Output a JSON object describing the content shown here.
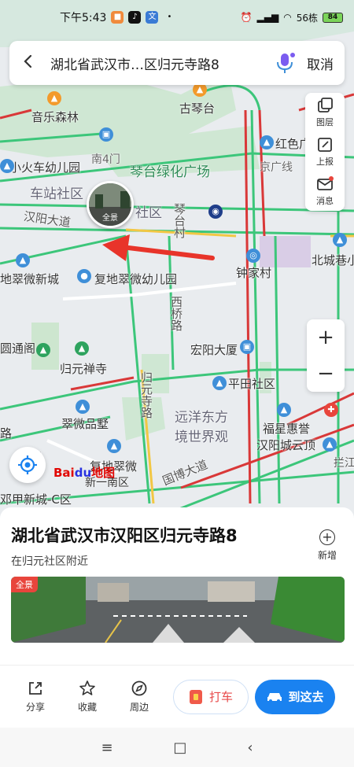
{
  "status_bar": {
    "time": "下午5:43",
    "network_speed": "56栋",
    "battery": "84"
  },
  "search": {
    "query": "湖北省武汉市…区归元寺路8",
    "cancel_label": "取消"
  },
  "map_tools": {
    "layers_label": "图层",
    "report_label": "上报",
    "messages_label": "消息"
  },
  "map": {
    "pano_marker_label": "全景",
    "logo_text_1": "Bai",
    "logo_text_2": "du",
    "logo_text_3": "地图",
    "labels": {
      "music_forest": "音乐森林",
      "guqintai": "古琴台",
      "south4gate": "南4门",
      "red_color": "红色广",
      "kindergarten_train": "小火车幼儿园",
      "qintai_square": "琴台绿化广场",
      "jingguang_line": "京广线",
      "station_community": "车站社区",
      "community_short": "社区",
      "qintai_village": "琴台村",
      "hanyang_avenue": "汉阳大道",
      "beicheng_alley": "北城巷小",
      "dicuiwei_new_city": "地翠微新城",
      "fudi_kindergarten": "复地翠微幼儿园",
      "zhongjia_village": "钟家村",
      "xiqiao_road": "西桥路",
      "yuantong_pavilion": "圆通阁",
      "hongyang_building": "宏阳大厦",
      "guiyuan_temple": "归元禅寺",
      "pingtian_community": "平田社区",
      "guiyuansi_road": "归元寺路",
      "cuiwei_villa": "翠微品墅",
      "yuanyang_dongfang": "远洋东方",
      "jingshi_jieguan": "境世界观",
      "fuxing_huiyu": "福星惠誉",
      "hanyang_cheng": "汉阳城云顶",
      "fudi_cuiwei": "复地翠微",
      "new_south_district": "新一南区",
      "guobo_avenue": "国博大道",
      "dengjia_new_city": "邓甲新城-C区",
      "road_e": "路",
      "yuan": "园",
      "lanjiang": "拦江"
    }
  },
  "place": {
    "title": "湖北省武汉市汉阳区归元寺路8",
    "subtitle": "在归元社区附近",
    "add_label": "新增",
    "pano_tag": "全景"
  },
  "actions": {
    "share": "分享",
    "favorite": "收藏",
    "nearby": "周边",
    "taxi": "打车",
    "go_here": "到这去"
  },
  "colors": {
    "primary": "#1a82f0",
    "road_green": "#3cc67a",
    "road_red": "#d93838",
    "road_yellow": "#f2c744",
    "arrow_red": "#e8342a"
  }
}
